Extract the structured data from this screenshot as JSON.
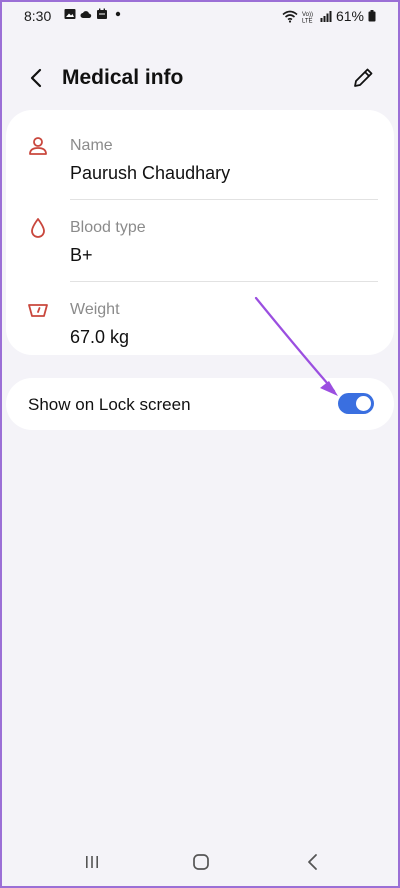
{
  "status_bar": {
    "time": "8:30",
    "battery": "61%",
    "left_icons": [
      "gallery-icon",
      "cloud-icon",
      "calendar-icon",
      "dot-icon"
    ],
    "right_icons": [
      "wifi-icon",
      "volte-icon",
      "signal-icon",
      "battery-icon"
    ]
  },
  "header": {
    "title": "Medical info",
    "back_icon": "chevron-left-icon",
    "edit_icon": "pencil-icon"
  },
  "info": {
    "rows": [
      {
        "label": "Name",
        "value": "Paurush Chaudhary",
        "icon": "person-icon"
      },
      {
        "label": "Blood type",
        "value": "B+",
        "icon": "blood-drop-icon"
      },
      {
        "label": "Weight",
        "value": "67.0 kg",
        "icon": "scale-icon"
      }
    ]
  },
  "lock_screen": {
    "label": "Show on Lock screen",
    "enabled": true
  },
  "nav_bar": {
    "icons": [
      "recents-icon",
      "home-icon",
      "back-icon"
    ]
  },
  "colors": {
    "accent": "#3a6fe0",
    "icon_red": "#c9473d",
    "annotation": "#9b4fe0",
    "background": "#f4f3f8"
  }
}
